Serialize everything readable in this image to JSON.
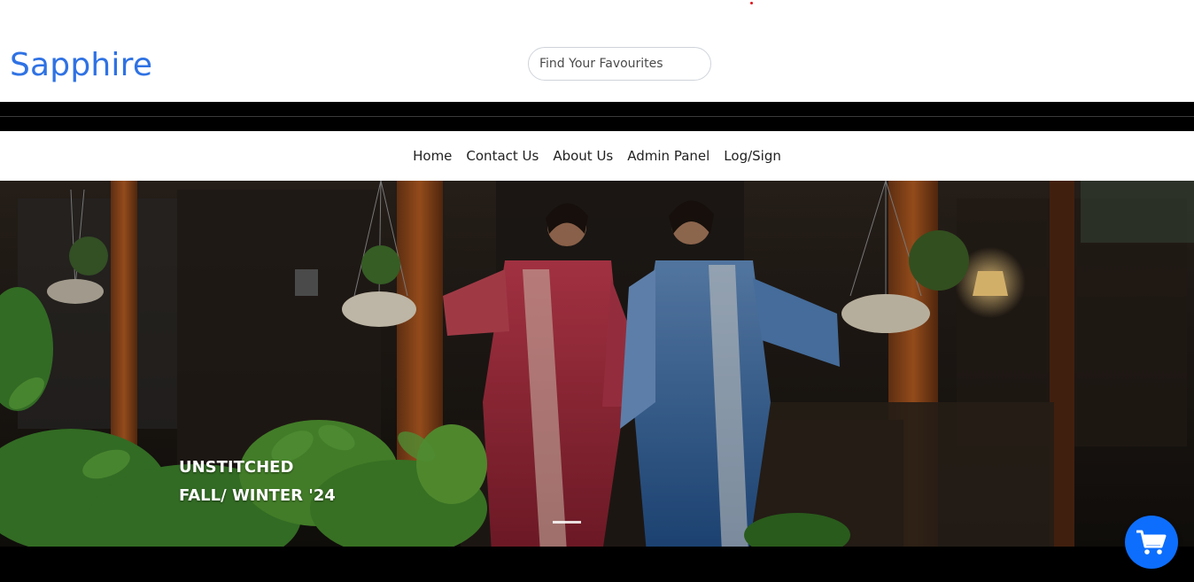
{
  "header": {
    "logo_text": "Sapphire",
    "logo_color": "#2f72e4",
    "search_placeholder": "Find Your Favourites",
    "accent_dot_color": "#e0101a"
  },
  "nav": {
    "items": [
      {
        "label": "Home"
      },
      {
        "label": "Contact Us"
      },
      {
        "label": "About Us"
      },
      {
        "label": "Admin Panel"
      },
      {
        "label": "Log/Sign"
      }
    ]
  },
  "hero": {
    "line1": "UNSTITCHED",
    "line2": "FALL/ WINTER '24",
    "image_subject": "two models in printed unstitched suits, red and blue, on a wooden porch with hanging planters"
  },
  "cart": {
    "icon": "shopping-cart-icon",
    "color": "#0d6efd"
  }
}
